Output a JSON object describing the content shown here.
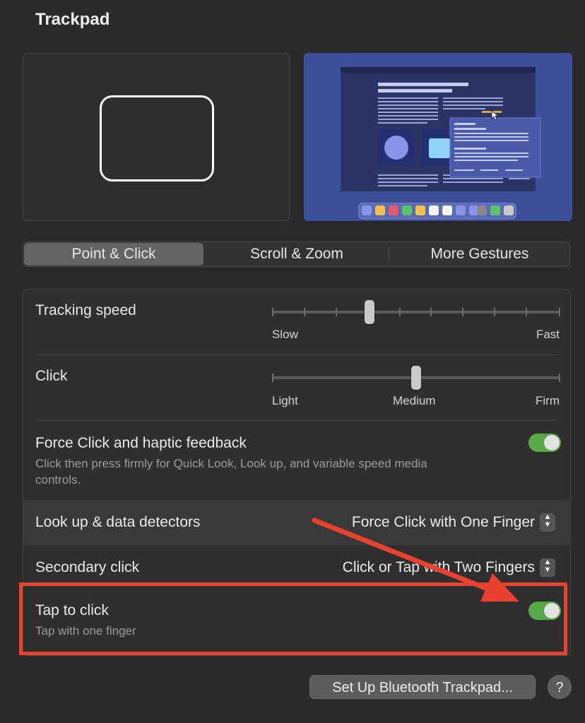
{
  "window": {
    "title": "Trackpad"
  },
  "tabs": [
    {
      "label": "Point & Click",
      "active": true
    },
    {
      "label": "Scroll & Zoom",
      "active": false
    },
    {
      "label": "More Gestures",
      "active": false
    }
  ],
  "settings": {
    "tracking_speed": {
      "label": "Tracking speed",
      "min_label": "Slow",
      "max_label": "Fast",
      "ticks": 10,
      "value_index": 3
    },
    "click": {
      "label": "Click",
      "min_label": "Light",
      "mid_label": "Medium",
      "max_label": "Firm",
      "ticks": 3,
      "value_index": 1
    },
    "force_click": {
      "label": "Force Click and haptic feedback",
      "description": "Click then press firmly for Quick Look, Look up, and variable speed media controls.",
      "enabled": true
    },
    "look_up": {
      "label": "Look up & data detectors",
      "value": "Force Click with One Finger"
    },
    "secondary_click": {
      "label": "Secondary click",
      "value": "Click or Tap with Two Fingers"
    },
    "tap_to_click": {
      "label": "Tap to click",
      "description": "Tap with one finger",
      "enabled": true
    }
  },
  "footer": {
    "bluetooth_button": "Set Up Bluetooth Trackpad...",
    "help_button": "?"
  },
  "annotation": {
    "highlight_color": "#e8422f",
    "arrow_color": "#e8422f"
  },
  "colors": {
    "toggle_on": "#58a84a",
    "background": "#2a2a2a"
  }
}
